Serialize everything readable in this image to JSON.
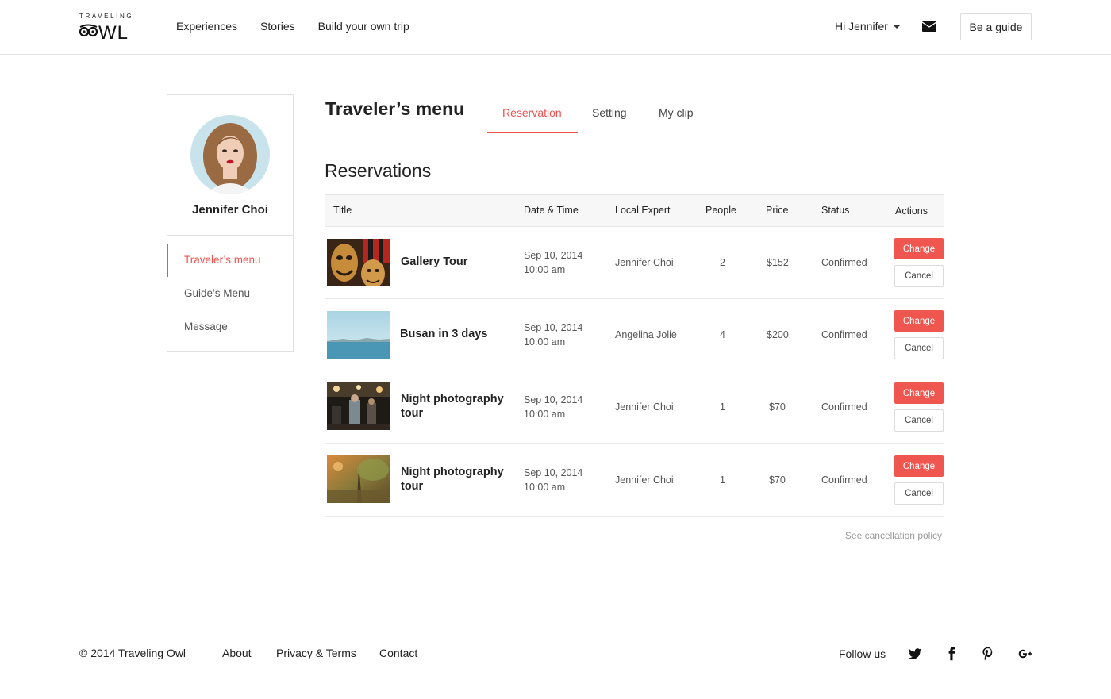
{
  "colors": {
    "accent": "#ef5350",
    "border": "#e3e3e3",
    "text": "#222222"
  },
  "header": {
    "logo_top": "TRAVELING",
    "logo_word": "OWL",
    "nav": [
      "Experiences",
      "Stories",
      "Build your own trip"
    ],
    "user_greeting": "Hi Jennifer",
    "mail_icon": "envelope-icon",
    "guide_button": "Be a guide"
  },
  "sidebar": {
    "user_name": "Jennifer Choi",
    "items": [
      {
        "label": "Traveler’s menu",
        "active": true
      },
      {
        "label": "Guide’s Menu",
        "active": false
      },
      {
        "label": "Message",
        "active": false
      }
    ]
  },
  "main": {
    "title": "Traveler’s menu",
    "tabs": [
      {
        "label": "Reservation",
        "active": true
      },
      {
        "label": "Setting",
        "active": false
      },
      {
        "label": "My clip",
        "active": false
      }
    ],
    "section_title": "Reservations",
    "columns": [
      "Title",
      "Date & Time",
      "Local Expert",
      "People",
      "Price",
      "Status",
      "Actions"
    ],
    "rows": [
      {
        "title": "Gallery Tour",
        "date": "Sep 10, 2014",
        "time": "10:00 am",
        "expert": "Jennifer Choi",
        "people": "2",
        "price": "$152",
        "status": "Confirmed",
        "change": "Change",
        "cancel": "Cancel",
        "thumb": "masks-photo"
      },
      {
        "title": "Busan in 3 days",
        "date": "Sep 10, 2014",
        "time": "10:00 am",
        "expert": "Angelina Jolie",
        "people": "4",
        "price": "$200",
        "status": "Confirmed",
        "change": "Change",
        "cancel": "Cancel",
        "thumb": "sea-photo"
      },
      {
        "title": "Night photography tour",
        "date": "Sep 10, 2014",
        "time": "10:00 am",
        "expert": "Jennifer Choi",
        "people": "1",
        "price": "$70",
        "status": "Confirmed",
        "change": "Change",
        "cancel": "Cancel",
        "thumb": "night-street-photo"
      },
      {
        "title": "Night photography tour",
        "date": "Sep 10, 2014",
        "time": "10:00 am",
        "expert": "Jennifer Choi",
        "people": "1",
        "price": "$70",
        "status": "Confirmed",
        "change": "Change",
        "cancel": "Cancel",
        "thumb": "forest-photo"
      }
    ],
    "policy_link": "See cancellation policy"
  },
  "footer": {
    "copyright": "© 2014  Traveling Owl",
    "links": [
      "About",
      "Privacy & Terms",
      "Contact"
    ],
    "follow": "Follow us",
    "social_icons": [
      "twitter-icon",
      "facebook-icon",
      "pinterest-icon",
      "google-plus-icon"
    ]
  }
}
